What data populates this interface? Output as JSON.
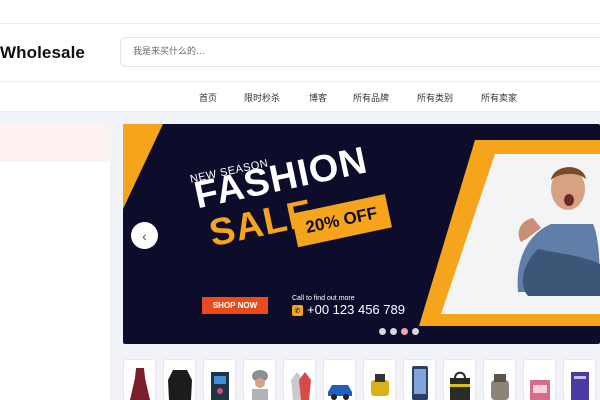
{
  "header": {
    "logo_text": "Wholesale",
    "search_placeholder": "我是来买什么的..."
  },
  "nav": {
    "items": [
      {
        "label": "首页",
        "name": "nav-home"
      },
      {
        "label": "限时秒杀",
        "name": "nav-flash-sale"
      },
      {
        "label": "博客",
        "name": "nav-blog"
      },
      {
        "label": "所有品牌",
        "name": "nav-all-brands"
      },
      {
        "label": "所有类别",
        "name": "nav-all-categories"
      },
      {
        "label": "所有卖家",
        "name": "nav-all-sellers"
      }
    ]
  },
  "banner": {
    "season": "NEW SEASON",
    "headline": "FASHION",
    "subheadline": "SALE",
    "discount": "20% OFF",
    "cta": "SHOP NOW",
    "call_label": "Call to find out more",
    "phone": "+00 123 456 789",
    "accent_color": "#f6a41c",
    "background_color": "#0d0c2b",
    "prev_icon": "chevron-left-icon",
    "slides": 4,
    "active_slide": 3
  },
  "products": {
    "items": [
      {
        "name": "dress",
        "color": "#7a1f2b"
      },
      {
        "name": "leather-jacket",
        "color": "#1c1c1c"
      },
      {
        "name": "gaming-pc",
        "color": "#223344"
      },
      {
        "name": "bucket-hat",
        "color": "#8a8f96"
      },
      {
        "name": "gloves",
        "color": "#c9c9cf"
      },
      {
        "name": "car",
        "color": "#1e5fbf"
      },
      {
        "name": "yellow-gadget",
        "color": "#d8b21a"
      },
      {
        "name": "smartphone",
        "color": "#2f3f63"
      },
      {
        "name": "bag",
        "color": "#2a2a2a"
      },
      {
        "name": "mixer",
        "color": "#8d8479"
      },
      {
        "name": "toy-bag",
        "color": "#d86a8a"
      },
      {
        "name": "notebook",
        "color": "#4b3aa0"
      }
    ]
  }
}
